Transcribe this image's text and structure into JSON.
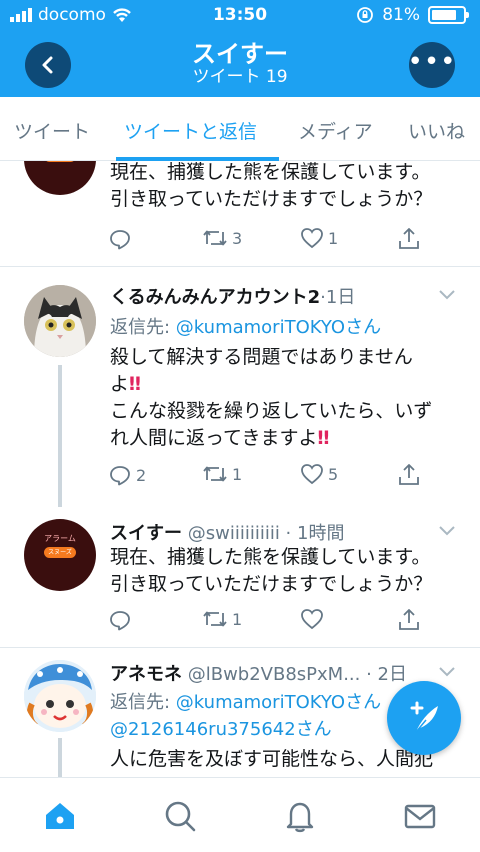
{
  "status_bar": {
    "carrier": "docomo",
    "time": "13:50",
    "battery": "81%",
    "battery_level": 0.81
  },
  "header": {
    "title": "スイすー",
    "subtitle": "ツイート 19",
    "more_label": "•••"
  },
  "tabs": [
    {
      "label": "ツイート"
    },
    {
      "label": "ツイートと返信"
    },
    {
      "label": "メディア"
    },
    {
      "label": "いいね"
    }
  ],
  "alarm_avatar": {
    "label": "アラーム",
    "pill": "スヌーズ"
  },
  "tweets": [
    {
      "text_lines": [
        "現在、捕獲した熊を保護しています。",
        "引き取っていただけますでしょうか？"
      ],
      "retweets": "3",
      "likes": "1"
    },
    {
      "name": "くるみんみんアカウント2",
      "meta": "·1日",
      "reply_prefix": "返信先: ",
      "reply_handle": "@kumamoriTOKYO",
      "reply_suffix": "さん",
      "line1": "殺して解決する問題ではありません",
      "line2": "よ",
      "excl": "‼",
      "line3": "こんな殺戮を繰り返していたら、いず",
      "line4": "れ人間に返ってきますよ",
      "replies": "2",
      "retweets": "1",
      "likes": "5"
    },
    {
      "name": "スイすー",
      "meta": " @swiiiiiiiiii · 1時間",
      "text_lines": [
        "現在、捕獲した熊を保護しています。",
        "引き取っていただけますでしょうか？"
      ],
      "retweets": "1"
    },
    {
      "name": "アネモネ",
      "meta": " @lBwb2VB8sPxM... · 2日",
      "reply_prefix": "返信先: ",
      "reply_handle": "@kumamoriTOKYO",
      "reply_suffix": "さん",
      "reply_handle2": "@2126146ru375642",
      "reply_suffix2": "さん",
      "text": "人に危害を及ぼす可能性なら、人間犯"
    }
  ],
  "bottom_nav": [
    "home-icon",
    "search-icon",
    "notifications-icon",
    "messages-icon"
  ],
  "colors": {
    "accent": "#1da1f2",
    "header_button": "#0e4a77",
    "muted": "#657786",
    "like_red": "#e0245e"
  }
}
